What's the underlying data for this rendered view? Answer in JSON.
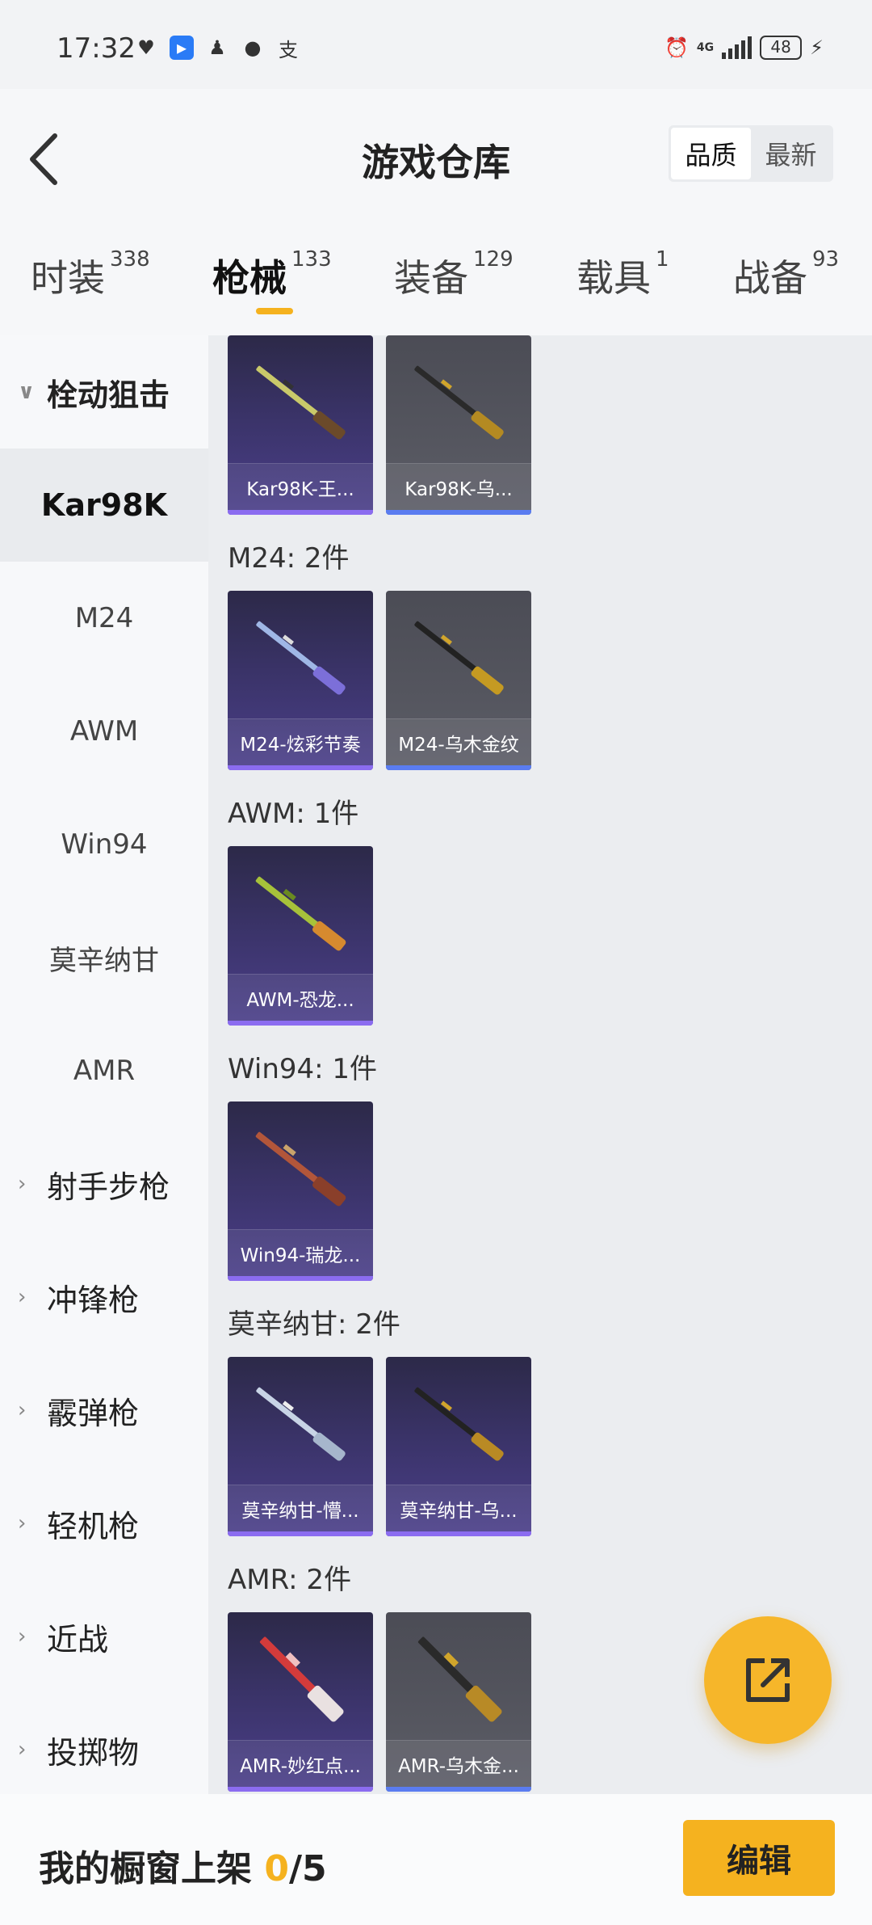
{
  "status_bar": {
    "time": "17:32",
    "signal_label": "4G",
    "battery": "48",
    "icons": [
      "heart-icon",
      "app-icon",
      "qq-icon",
      "message-icon",
      "alipay-icon",
      "alarm-icon",
      "signal-icon",
      "battery-icon",
      "charging-icon"
    ]
  },
  "header": {
    "title": "游戏仓库",
    "sort": {
      "quality": "品质",
      "latest": "最新",
      "active": "quality"
    }
  },
  "tabs": [
    {
      "label": "时装",
      "count": "338"
    },
    {
      "label": "枪械",
      "count": "133",
      "active": true
    },
    {
      "label": "装备",
      "count": "129"
    },
    {
      "label": "载具",
      "count": "1"
    },
    {
      "label": "战备",
      "count": "93"
    }
  ],
  "sidebar": {
    "parent": "栓动狙击",
    "children": [
      "Kar98K",
      "M24",
      "AWM",
      "Win94",
      "莫辛纳甘",
      "AMR"
    ],
    "selected": "Kar98K",
    "groups": [
      "射手步枪",
      "冲锋枪",
      "霰弹枪",
      "轻机枪",
      "近战",
      "投掷物"
    ]
  },
  "sections": [
    {
      "label": "",
      "items": [
        {
          "name": "Kar98K-王...",
          "color": "#3a3368"
        },
        {
          "name": "Kar98K-乌...",
          "color": "#55565f"
        }
      ]
    },
    {
      "label": "M24: 2件",
      "items": [
        {
          "name": "M24-炫彩节奏",
          "color": "#3a3368"
        },
        {
          "name": "M24-乌木金纹",
          "color": "#55565f"
        }
      ]
    },
    {
      "label": "AWM: 1件",
      "items": [
        {
          "name": "AWM-恐龙...",
          "color": "#3a3368"
        }
      ]
    },
    {
      "label": "Win94: 1件",
      "items": [
        {
          "name": "Win94-瑞龙...",
          "color": "#3a3368"
        }
      ]
    },
    {
      "label": "莫辛纳甘: 2件",
      "items": [
        {
          "name": "莫辛纳甘-懵...",
          "color": "#3a3368"
        },
        {
          "name": "莫辛纳甘-乌...",
          "color": "#3a3368"
        }
      ]
    },
    {
      "label": "AMR: 2件",
      "items": [
        {
          "name": "AMR-妙红点...",
          "color": "#3a3368"
        },
        {
          "name": "AMR-乌木金...",
          "color": "#55565f"
        }
      ]
    }
  ],
  "bottom": {
    "shelf_prefix": "我的橱窗上架 ",
    "shelf_current": "0",
    "shelf_total": "/5",
    "edit_label": "编辑"
  },
  "colors": {
    "accent": "#f5b21f",
    "card_purple": "#3a3368",
    "card_gray": "#55565f"
  }
}
